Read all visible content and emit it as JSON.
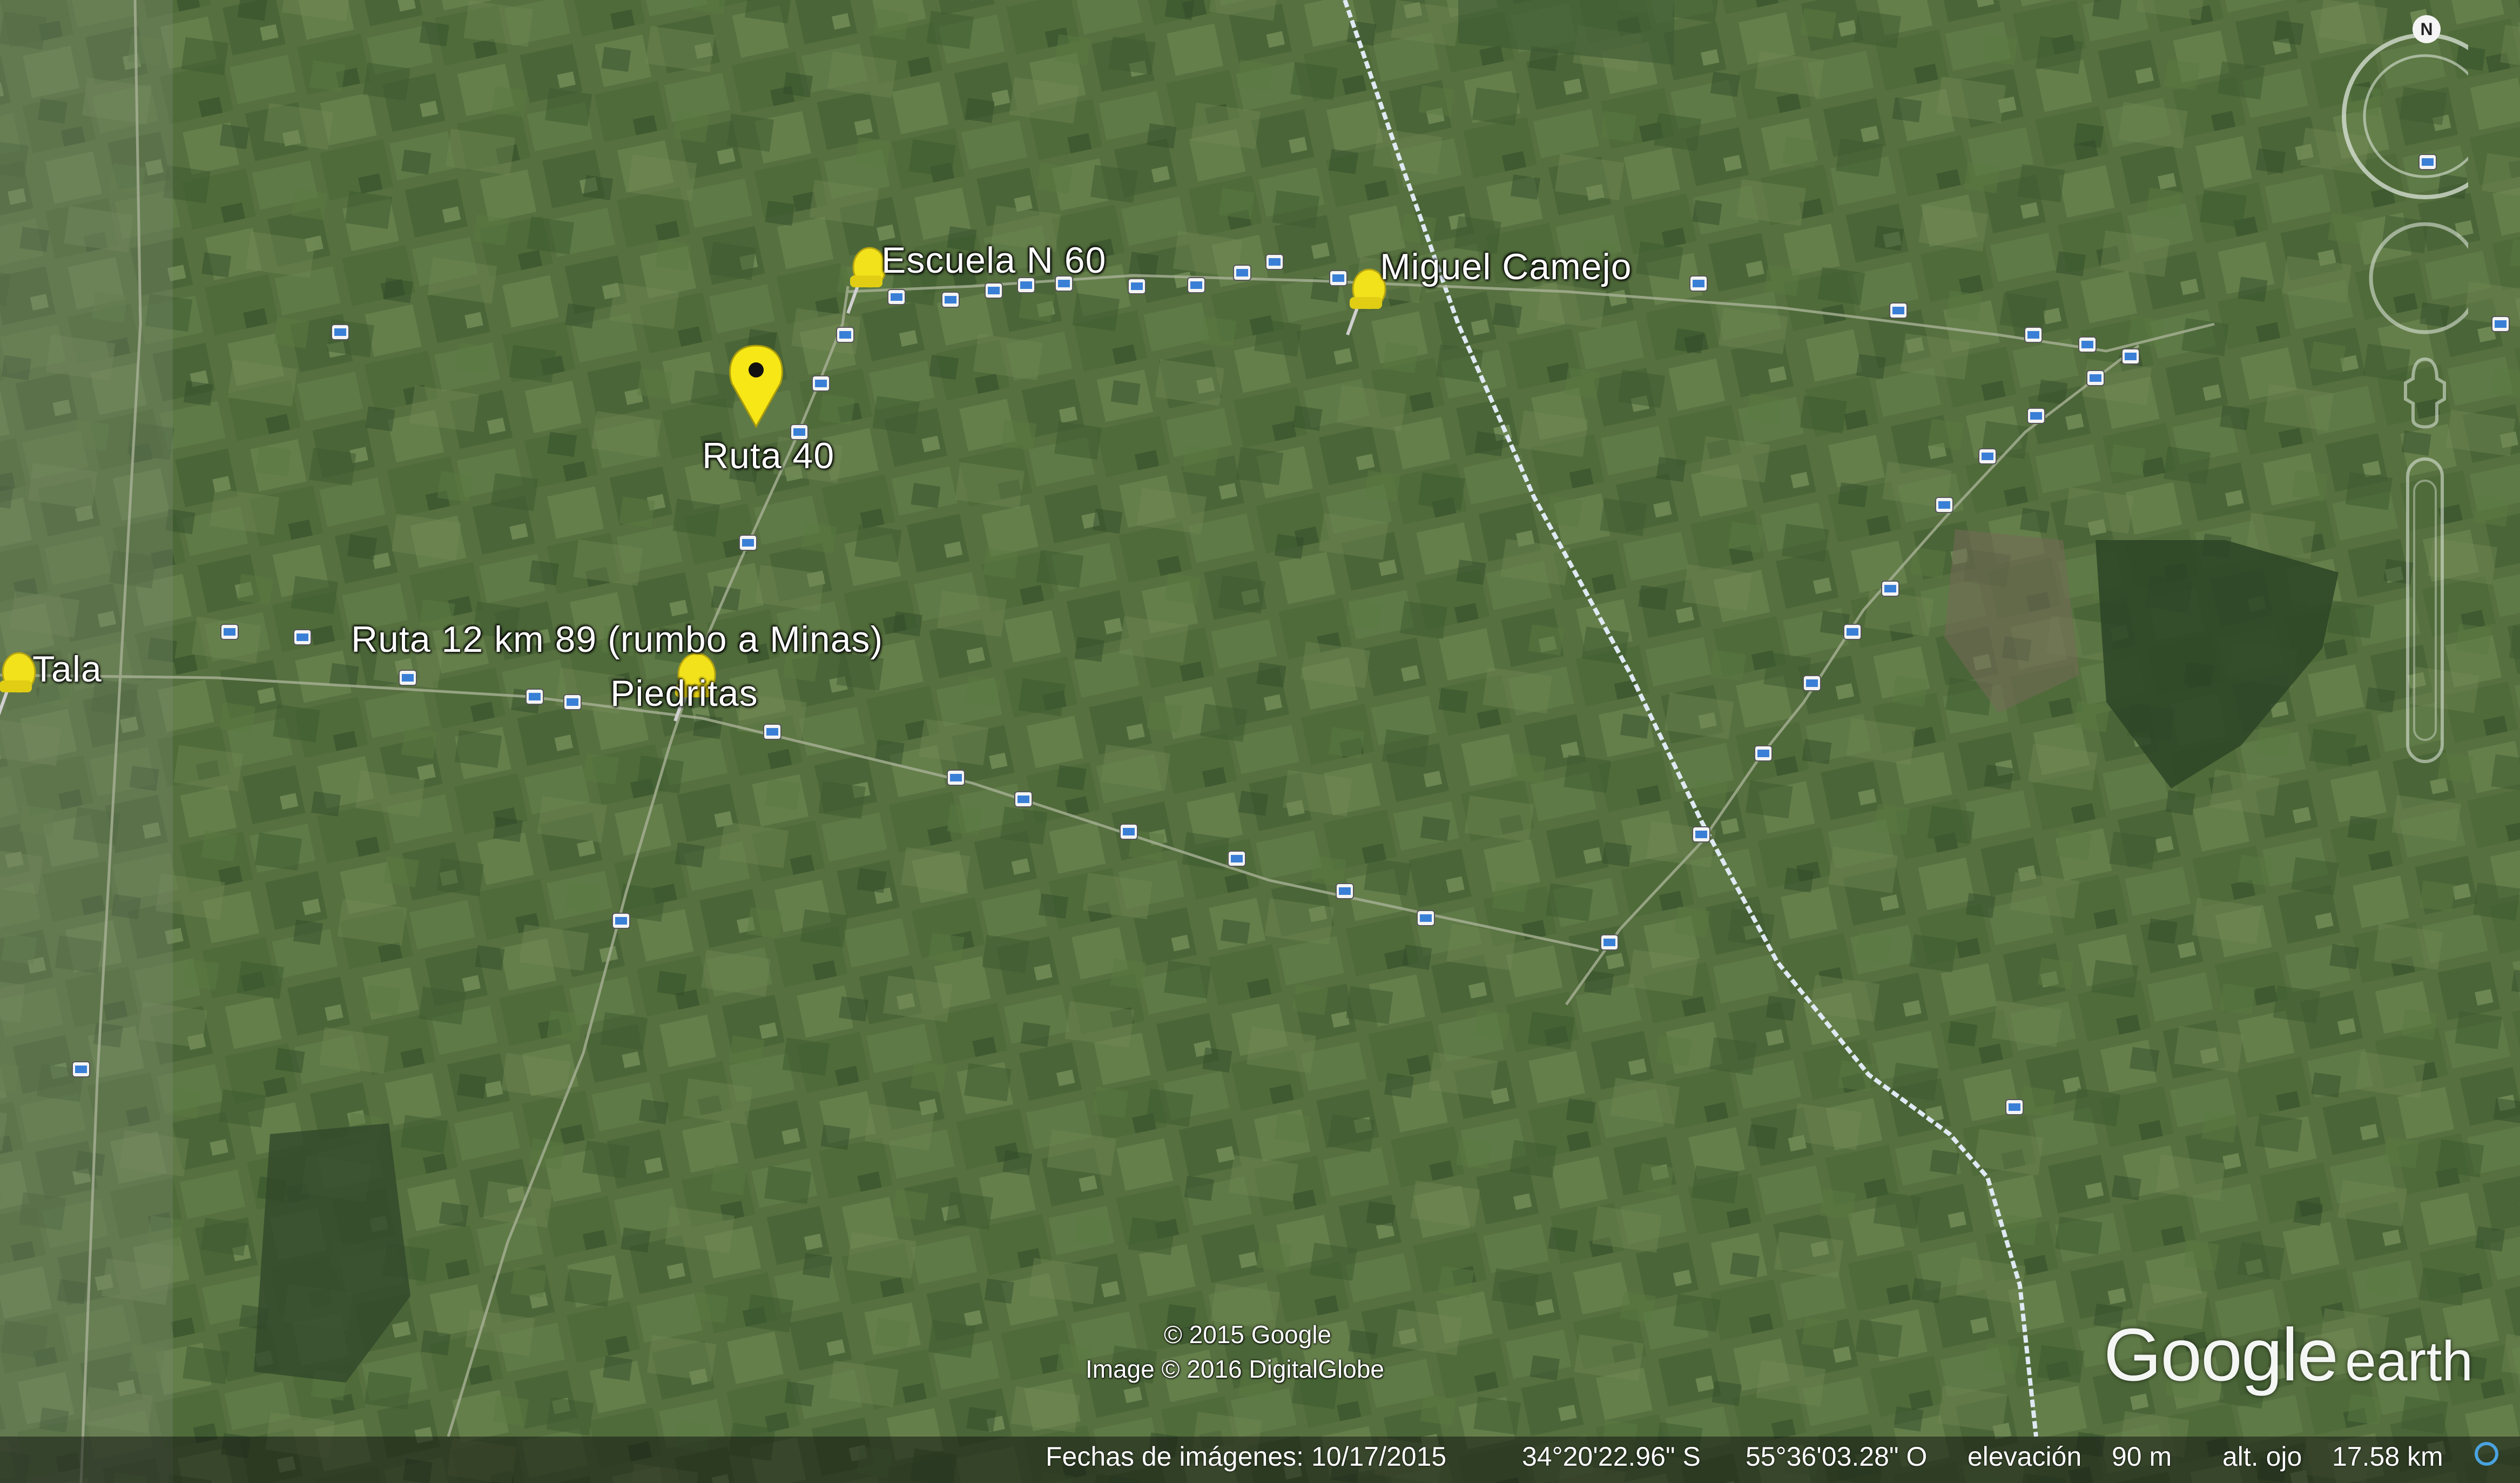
{
  "map": {
    "type": "satellite",
    "placemarks": [
      {
        "label": "Escuela N 60",
        "icon": "yellow-pushpin"
      },
      {
        "label": "Miguel Camejo",
        "icon": "yellow-pushpin"
      },
      {
        "label": "Ruta 40",
        "icon": "yellow-map-pin"
      },
      {
        "label": "Tala",
        "icon": "yellow-pushpin"
      },
      {
        "label": "Ruta 12 km 89 (rumbo a Minas)",
        "icon": "text-label"
      },
      {
        "label": "Piedritas",
        "icon": "yellow-pushpin"
      }
    ],
    "colors": {
      "pin": "#f2e21c",
      "road_marker": "#3a7fd6",
      "railway": "#d9e6f2",
      "terrain": "#55703f"
    }
  },
  "credits": {
    "google": "© 2015 Google",
    "imagery": "Image © 2016 DigitalGlobe"
  },
  "brand": {
    "google": "Google",
    "earth": "earth"
  },
  "navigation": {
    "north": "N"
  },
  "status_bar": {
    "imagery_date": "Fechas de imágenes: 10/17/2015",
    "latitude": "34°20'22.96\" S",
    "longitude": "55°36'03.28\" O",
    "elevation_label": "elevación",
    "elevation_value": "90 m",
    "eye_alt_label": "alt. ojo",
    "eye_alt_value": "17.58 km"
  }
}
